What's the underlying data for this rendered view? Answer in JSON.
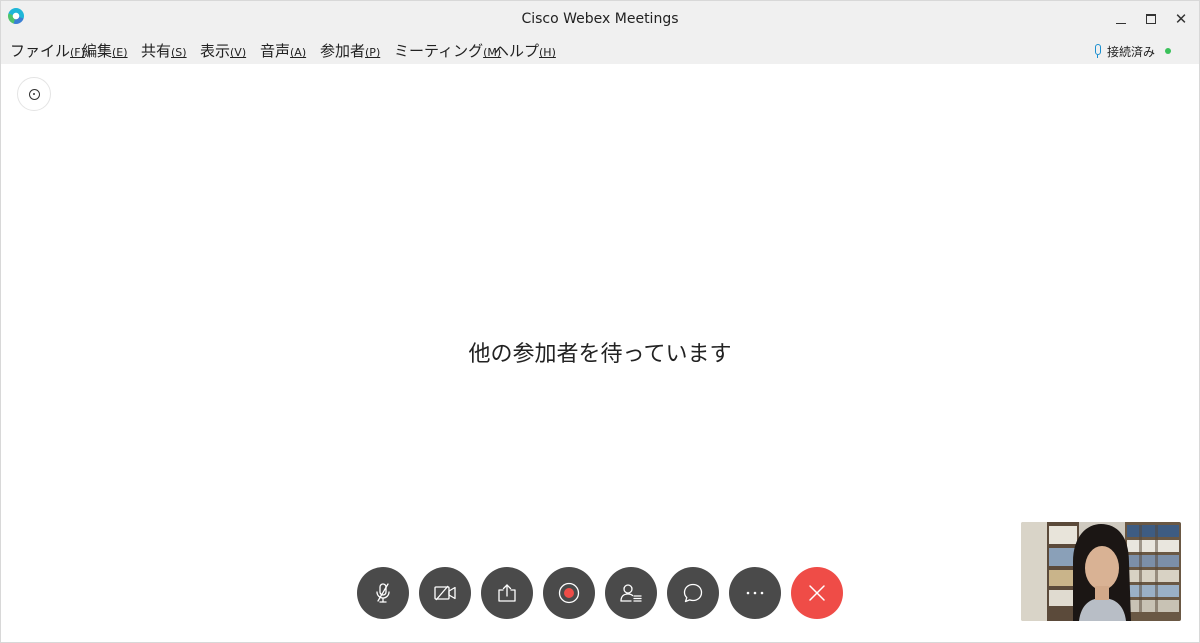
{
  "window": {
    "title": "Cisco Webex Meetings"
  },
  "menu": {
    "items": [
      {
        "label": "ファイル",
        "accel": "(F)"
      },
      {
        "label": "編集",
        "accel": "(E)"
      },
      {
        "label": "共有",
        "accel": "(S)"
      },
      {
        "label": "表示",
        "accel": "(V)"
      },
      {
        "label": "音声",
        "accel": "(A)"
      },
      {
        "label": "参加者",
        "accel": "(P)"
      },
      {
        "label": "ミーティング",
        "accel": "(M)"
      },
      {
        "label": "ヘルプ",
        "accel": "(H)"
      }
    ]
  },
  "status": {
    "label": "接続済み",
    "dot_color": "#3ac15a"
  },
  "main": {
    "waiting_text": "他の参加者を待っています"
  },
  "controls": [
    {
      "name": "mute-button",
      "icon": "muted-mic-icon"
    },
    {
      "name": "video-button",
      "icon": "video-off-icon"
    },
    {
      "name": "share-button",
      "icon": "share-icon"
    },
    {
      "name": "record-button",
      "icon": "record-icon"
    },
    {
      "name": "participants-button",
      "icon": "participants-icon"
    },
    {
      "name": "chat-button",
      "icon": "chat-icon"
    },
    {
      "name": "more-button",
      "icon": "more-icon"
    },
    {
      "name": "end-meeting-button",
      "icon": "close-icon"
    }
  ],
  "colors": {
    "control_bg": "#4a4a4a",
    "end_button": "#ef4c47",
    "record_dot": "#ef4c47"
  }
}
